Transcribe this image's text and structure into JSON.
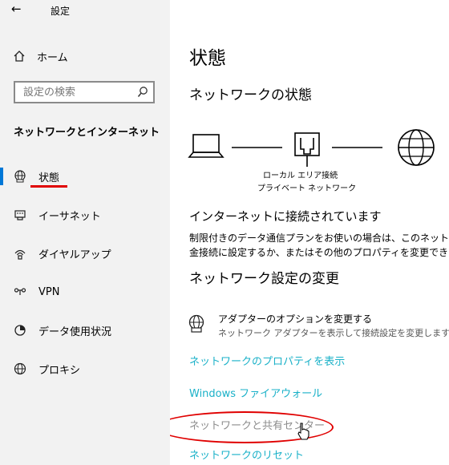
{
  "window": {
    "title": "設定",
    "back_icon": "back-arrow-icon"
  },
  "sidebar": {
    "home": {
      "label": "ホーム",
      "icon": "home-icon"
    },
    "search": {
      "placeholder": "設定の検索",
      "icon": "search-icon"
    },
    "section_title": "ネットワークとインターネット",
    "items": [
      {
        "label": "状態",
        "icon": "globe-status-icon",
        "selected": true
      },
      {
        "label": "イーサネット",
        "icon": "ethernet-icon"
      },
      {
        "label": "ダイヤルアップ",
        "icon": "dialup-icon"
      },
      {
        "label": "VPN",
        "icon": "vpn-icon"
      },
      {
        "label": "データ使用状況",
        "icon": "data-usage-icon"
      },
      {
        "label": "プロキシ",
        "icon": "globe-icon"
      }
    ],
    "accent_color": "#0078d7"
  },
  "main": {
    "page_title": "状態",
    "network_status_heading": "ネットワークの状態",
    "diagram": {
      "network_name": "ローカル エリア接続",
      "network_type": "プライベート ネットワーク"
    },
    "connection_status": "インターネットに接続されています",
    "description_lines": [
      "制限付きのデータ通信プランをお使いの場合は、このネットワ",
      "金接続に設定するか、またはその他のプロパティを変更できま"
    ],
    "change_settings_heading": "ネットワーク設定の変更",
    "adapter": {
      "title": "アダプターのオプションを変更する",
      "subtitle": "ネットワーク アダプターを表示して接続設定を変更します。",
      "icon": "adapter-globe-icon"
    },
    "links": [
      "ネットワークのプロパティを表示",
      "Windows ファイアウォール",
      "ネットワークと共有センター",
      "ネットワークのリセット"
    ],
    "link_color": "#1ab1c8"
  },
  "annotation_color": "#e00000"
}
